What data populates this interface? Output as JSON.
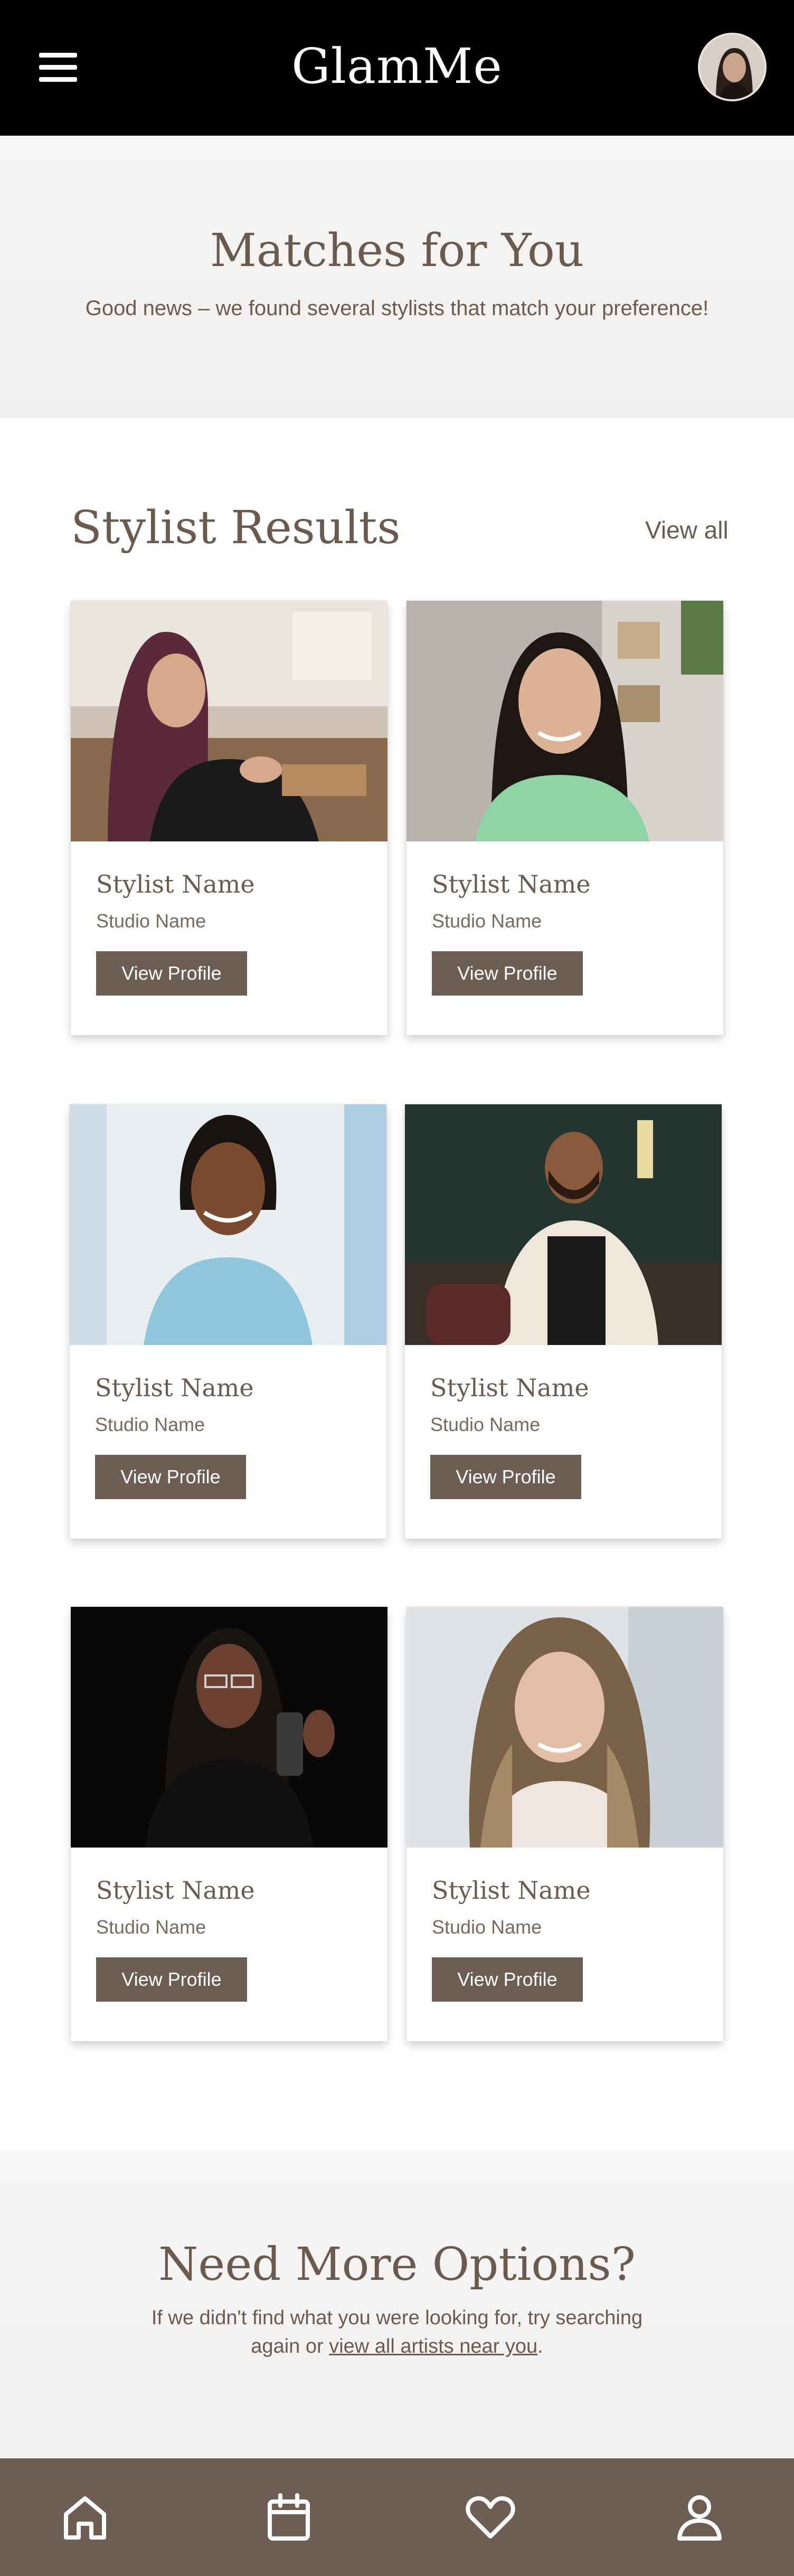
{
  "header": {
    "app_name": "GlamMe",
    "menu_icon": "hamburger-menu-icon",
    "avatar": "user-avatar"
  },
  "hero": {
    "title": "Matches for You",
    "subtitle": "Good news – we found several stylists that match your preference!"
  },
  "results": {
    "title": "Stylist Results",
    "view_all": "View all",
    "cards": [
      {
        "name": "Stylist Name",
        "studio": "Studio Name",
        "button": "View Profile"
      },
      {
        "name": "Stylist Name",
        "studio": "Studio Name",
        "button": "View Profile"
      },
      {
        "name": "Stylist Name",
        "studio": "Studio Name",
        "button": "View Profile"
      },
      {
        "name": "Stylist Name",
        "studio": "Studio Name",
        "button": "View Profile"
      },
      {
        "name": "Stylist Name",
        "studio": "Studio Name",
        "button": "View Profile"
      },
      {
        "name": "Stylist Name",
        "studio": "Studio Name",
        "button": "View Profile"
      }
    ]
  },
  "cta": {
    "title": "Need More Options?",
    "line1": "If we didn't find what you were looking for, try searching",
    "line2_prefix": "again or ",
    "link": "view all artists near you",
    "line2_suffix": "."
  },
  "bottom_nav": {
    "items": [
      "home-icon",
      "calendar-icon",
      "heart-icon",
      "profile-icon"
    ]
  },
  "colors": {
    "header_bg": "#000000",
    "brand_brown": "#6e5d52",
    "text_brown": "#6b5a4e",
    "hero_bg": "#f6f4f2"
  }
}
